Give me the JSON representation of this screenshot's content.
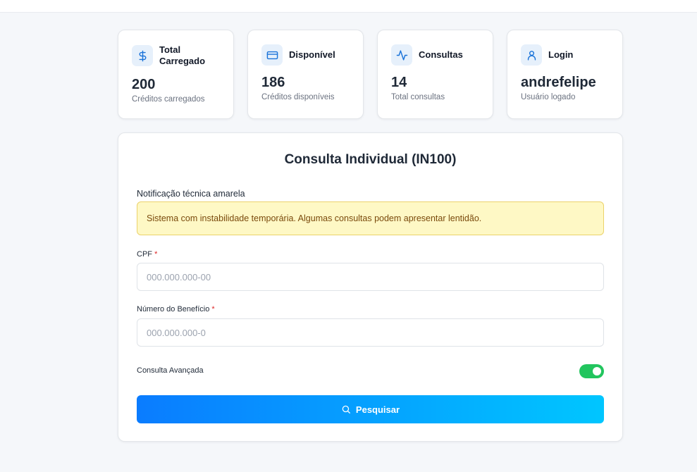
{
  "stats": [
    {
      "icon": "dollar-icon",
      "title": "Total Carregado",
      "value": "200",
      "sub": "Créditos carregados"
    },
    {
      "icon": "credit-card-icon",
      "title": "Disponível",
      "value": "186",
      "sub": "Créditos disponíveis"
    },
    {
      "icon": "activity-icon",
      "title": "Consultas",
      "value": "14",
      "sub": "Total consultas"
    },
    {
      "icon": "user-icon",
      "title": "Login",
      "value": "andrefelipe",
      "sub": "Usuário logado"
    }
  ],
  "form": {
    "title": "Consulta Individual (IN100)",
    "notification_label": "Notificação técnica amarela",
    "notification_text": "Sistema com instabilidade temporária. Algumas consultas podem apresentar lentidão.",
    "cpf_label": "CPF",
    "cpf_placeholder": "000.000.000-00",
    "beneficio_label": "Número do Benefício",
    "beneficio_placeholder": "000.000.000-0",
    "required_mark": "*",
    "advanced_label": "Consulta Avançada",
    "advanced_enabled": true,
    "search_button": "Pesquisar"
  },
  "colors": {
    "accent_start": "#0a7cff",
    "accent_end": "#00c6ff",
    "toggle_on": "#22c55e",
    "warning_bg": "#fef8c5",
    "warning_text": "#7a4a0c"
  }
}
